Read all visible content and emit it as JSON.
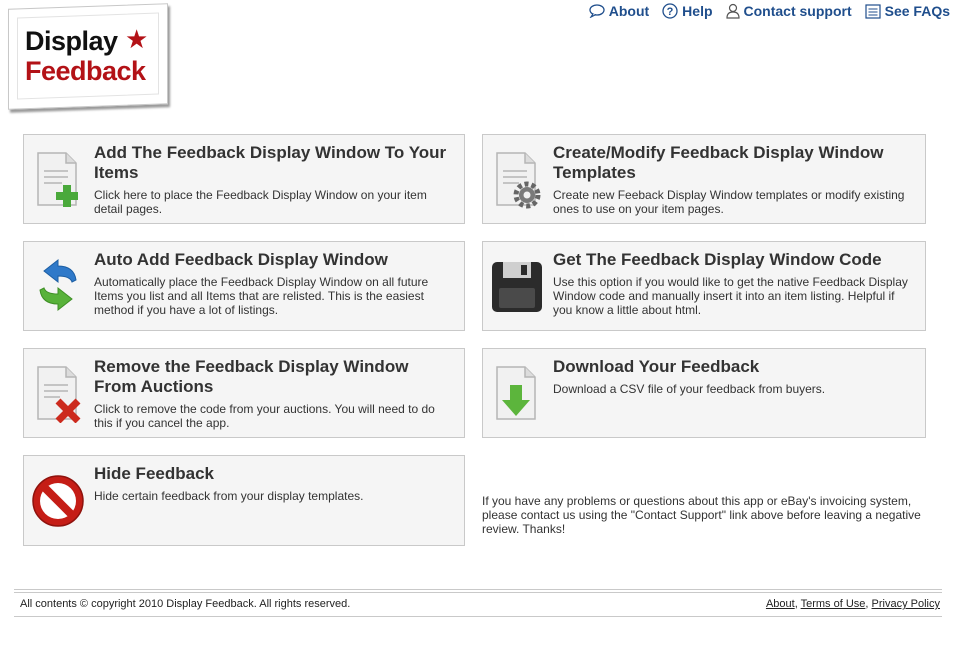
{
  "logo": {
    "line1": "Display",
    "star": "★",
    "line2": "Feedback",
    "colors": {
      "accent": "#b31217",
      "text": "#111111"
    }
  },
  "nav": [
    {
      "label": "About",
      "icon": "speech-bubble-icon"
    },
    {
      "label": "Help",
      "icon": "question-circle-icon"
    },
    {
      "label": "Contact support",
      "icon": "person-icon"
    },
    {
      "label": "See FAQs",
      "icon": "document-list-icon"
    }
  ],
  "tiles": [
    {
      "title": "Add The Feedback Display Window To Your Items",
      "desc": "Click here to place the Feedback Display Window on your item detail pages.",
      "icon": "document-add-icon"
    },
    {
      "title": "Create/Modify Feedback Display Window Templates",
      "desc": "Create new Feeback Display Window templates or modify existing ones to use on your item pages.",
      "icon": "document-gear-icon"
    },
    {
      "title": "Auto Add Feedback Display Window",
      "desc": "Automatically place the Feedback Display Window on all future Items you list and all Items that are relisted. This is the easiest method if you have a lot of listings.",
      "icon": "sync-arrows-icon"
    },
    {
      "title": "Get The Feedback Display Window Code",
      "desc": "Use this option if you would like to get the native Feedback Display Window code and manually insert it into an item listing. Helpful if you know a little about html.",
      "icon": "floppy-disk-icon"
    },
    {
      "title": "Remove the Feedback Display Window From Auctions",
      "desc": "Click to remove the code from your auctions. You will need to do this if you cancel the app.",
      "icon": "document-remove-icon"
    },
    {
      "title": "Download Your Feedback",
      "desc": "Download a CSV file of your feedback from buyers.",
      "icon": "document-download-icon"
    },
    {
      "title": "Hide Feedback",
      "desc": "Hide certain feedback from your display templates.",
      "icon": "no-entry-icon"
    }
  ],
  "note": "If you have any problems or questions about this app or eBay's invoicing system, please contact us using the \"Contact Support\" link above before leaving a negative review. Thanks!",
  "footer": {
    "copyright": "All contents © copyright 2010 Display Feedback. All rights reserved.",
    "links": [
      "About",
      "Terms of Use",
      "Privacy Policy"
    ],
    "separator": ","
  }
}
